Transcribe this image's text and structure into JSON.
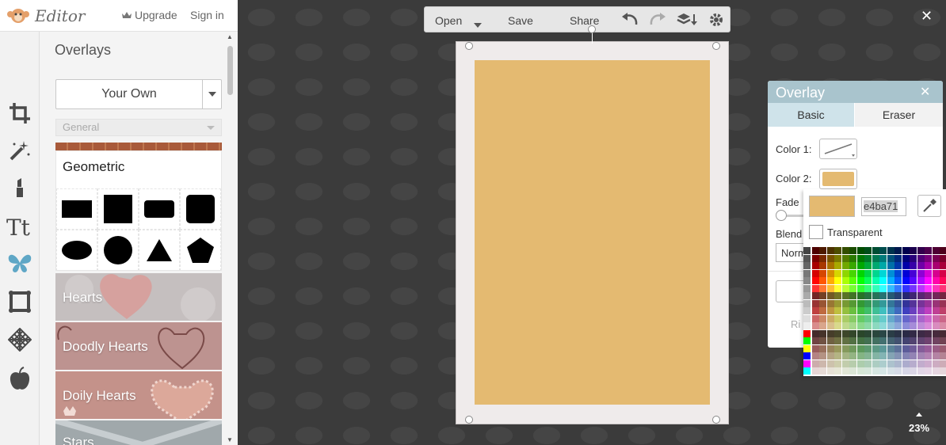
{
  "header": {
    "logo_text": "Editor",
    "upgrade_label": "Upgrade",
    "signin_label": "Sign in"
  },
  "rail": [
    {
      "name": "crop-icon"
    },
    {
      "name": "magic-wand-icon"
    },
    {
      "name": "lipstick-icon"
    },
    {
      "name": "text-icon"
    },
    {
      "name": "butterfly-icon"
    },
    {
      "name": "frame-icon"
    },
    {
      "name": "texture-icon"
    },
    {
      "name": "apple-icon"
    }
  ],
  "panel": {
    "title": "Overlays",
    "source_select": "Your Own",
    "category_select": "General",
    "geometric_title": "Geometric",
    "overlays": [
      "Hearts",
      "Doodly Hearts",
      "Doily Hearts",
      "Stars"
    ]
  },
  "toolbar": {
    "open": "Open",
    "save": "Save",
    "share": "Share"
  },
  "zoom": "23%",
  "dialog": {
    "title": "Overlay",
    "tab_basic": "Basic",
    "tab_eraser": "Eraser",
    "color1": "Color 1:",
    "color2": "Color 2:",
    "fade": "Fade",
    "blend": "Blend",
    "blend_value": "Norm",
    "reset_partial": "Ri"
  },
  "picker": {
    "hex": "e4ba71",
    "transparent": "Transparent",
    "selected_color": "#e4ba71"
  },
  "colors": {
    "accent": "#5fa7c6",
    "doc_fill": "#e4ba71",
    "dialog_head": "#a9c4cd"
  }
}
